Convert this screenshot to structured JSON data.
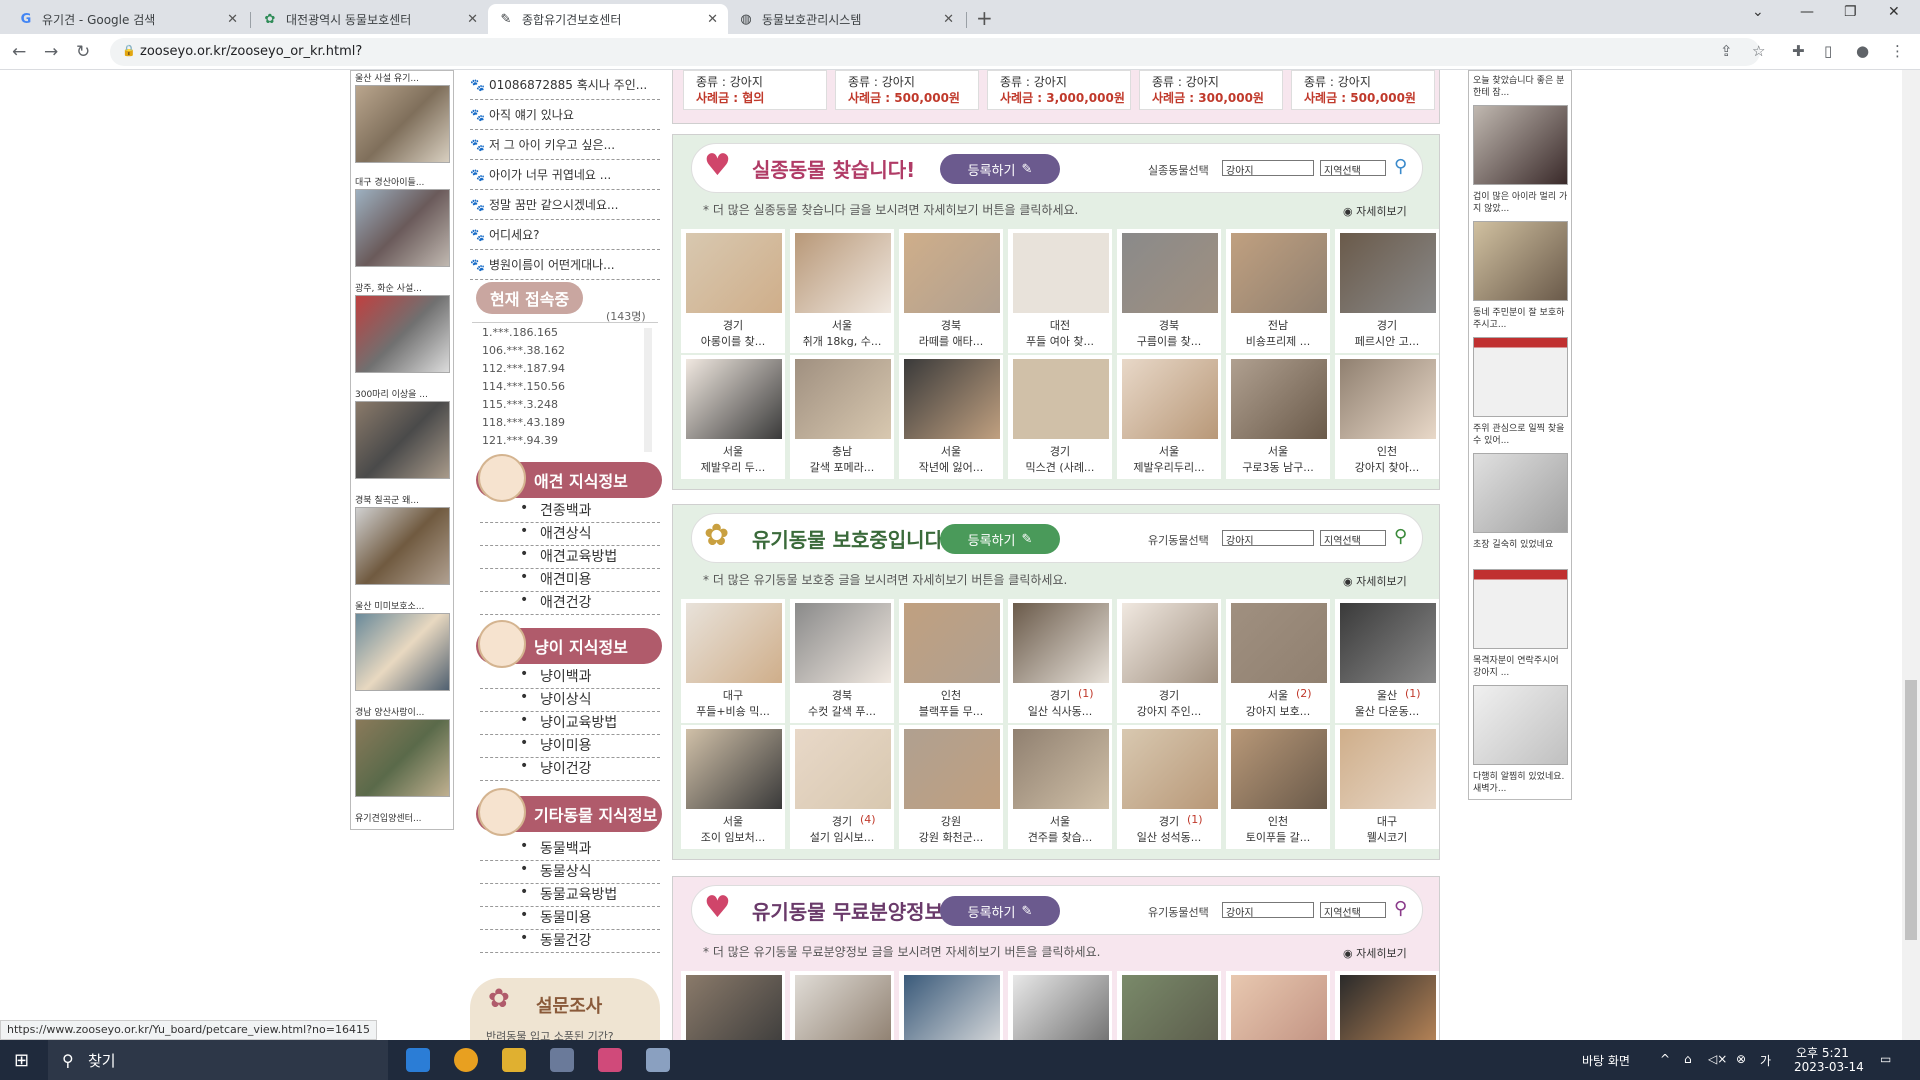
{
  "tabs": [
    {
      "title": "유기견 - Google 검색",
      "icon": "G"
    },
    {
      "title": "대전광역시 동물보호센터",
      "icon": "✿"
    },
    {
      "title": "종합유기견보호센터",
      "icon": "✎"
    },
    {
      "title": "동물보호관리시스템",
      "icon": "◍"
    }
  ],
  "url": "zooseyo.or.kr/zooseyo_or_kr.html?",
  "status_url": "https://www.zooseyo.or.kr/Yu_board/petcare_view.html?no=16415",
  "left_captions": [
    "울산 사설 유기...",
    "대구 경산아이들...",
    "광주, 화순 사설...",
    "300마리 이상을 ...",
    "경북 칠곡군 왜...",
    "울산 미미보호소...",
    "경남 양산사랑이...",
    "유기견입양센터..."
  ],
  "menu_items": [
    "01086872885 혹시나 주인...",
    "아직 얘기 있나요",
    "저 그 아이 키우고 싶은...",
    "아이가 너무 귀엽네요 ...",
    "정말 꿈만 같으시겠네요...",
    "어디세요?",
    "병원이름이 어떤게대나..."
  ],
  "now_online": {
    "label": "현재 접속중",
    "count": "(143명)",
    "ips": [
      "1.***.186.165",
      "106.***.38.162",
      "112.***.187.94",
      "114.***.150.56",
      "115.***.3.248",
      "118.***.43.189",
      "121.***.94.39"
    ]
  },
  "knowledge": [
    {
      "title": "애견 지식정보",
      "links": [
        "견종백과",
        "애견상식",
        "애견교육방법",
        "애견미용",
        "애견건강"
      ]
    },
    {
      "title": "냥이 지식정보",
      "links": [
        "냥이백과",
        "냥이상식",
        "냥이교육방법",
        "냥이미용",
        "냥이건강"
      ]
    },
    {
      "title": "기타동물 지식정보",
      "links": [
        "동물백과",
        "동물상식",
        "동물교육방법",
        "동물미용",
        "동물건강"
      ]
    }
  ],
  "survey": {
    "title": "설문조사",
    "text": "반려동물 입고 소풍된 기간?"
  },
  "top_rewards": [
    {
      "species": "종류 : 강아지",
      "reward": "사례금 : 협의"
    },
    {
      "species": "종류 : 강아지",
      "reward": "사례금 : 500,000원"
    },
    {
      "species": "종류 : 강아지",
      "reward": "사례금 : 3,000,000원"
    },
    {
      "species": "종류 : 강아지",
      "reward": "사례금 : 300,000원"
    },
    {
      "species": "종류 : 강아지",
      "reward": "사례금 : 500,000원"
    }
  ],
  "sections": [
    {
      "title": "실종동물 찾습니다!",
      "register": "등록하기",
      "select_label": "실종동물선택",
      "select_value": "강아지",
      "region": "지역선택",
      "note": "* 더 많은 실종동물 찾습니다 글을 보시려면 자세히보기 버튼을 클릭하세요.",
      "more": "자세히보기",
      "cards": [
        {
          "region": "경기",
          "text": "아롱이를 찾...",
          "count": ""
        },
        {
          "region": "서울",
          "text": "취개 18kg, 수...",
          "count": ""
        },
        {
          "region": "경북",
          "text": "라떼를 애타...",
          "count": ""
        },
        {
          "region": "대전",
          "text": "푸들 여아 찾...",
          "count": ""
        },
        {
          "region": "경북",
          "text": "구름이를 찾...",
          "count": ""
        },
        {
          "region": "전남",
          "text": "비숑프리제 ...",
          "count": ""
        },
        {
          "region": "경기",
          "text": "페르시안 고...",
          "count": ""
        },
        {
          "region": "서울",
          "text": "제발우리 두...",
          "count": ""
        },
        {
          "region": "충남",
          "text": "갈색 포메라...",
          "count": ""
        },
        {
          "region": "서울",
          "text": "작년에 잃어...",
          "count": ""
        },
        {
          "region": "경기",
          "text": "믹스견 (사례...",
          "count": ""
        },
        {
          "region": "서울",
          "text": "제발우리두리...",
          "count": ""
        },
        {
          "region": "서울",
          "text": "구로3동 남구...",
          "count": ""
        },
        {
          "region": "인천",
          "text": "강아지 찾아...",
          "count": ""
        }
      ]
    },
    {
      "title": "유기동물 보호중입니다!",
      "register": "등록하기",
      "select_label": "유기동물선택",
      "select_value": "강아지",
      "region": "지역선택",
      "note": "* 더 많은 유기동물 보호중 글을 보시려면 자세히보기 버튼을 클릭하세요.",
      "more": "자세히보기",
      "cards": [
        {
          "region": "대구",
          "text": "푸들+비숑 믹...",
          "count": ""
        },
        {
          "region": "경북",
          "text": "수컷 갈색 푸...",
          "count": ""
        },
        {
          "region": "인천",
          "text": "블랙푸들 무...",
          "count": ""
        },
        {
          "region": "경기",
          "text": "일산 식사동...",
          "count": "(1)"
        },
        {
          "region": "경기",
          "text": "강아지 주인...",
          "count": ""
        },
        {
          "region": "서울",
          "text": "강아지 보호...",
          "count": "(2)"
        },
        {
          "region": "울산",
          "text": "울산 다운동...",
          "count": "(1)"
        },
        {
          "region": "서울",
          "text": "조이 임보처...",
          "count": ""
        },
        {
          "region": "경기",
          "text": "설기 임시보...",
          "count": "(4)"
        },
        {
          "region": "강원",
          "text": "강원 화천군...",
          "count": ""
        },
        {
          "region": "서울",
          "text": "견주를 찾습...",
          "count": ""
        },
        {
          "region": "경기",
          "text": "일산 성석동...",
          "count": "(1)"
        },
        {
          "region": "인천",
          "text": "토이푸들 갈...",
          "count": ""
        },
        {
          "region": "대구",
          "text": "웰시코기",
          "count": ""
        }
      ]
    },
    {
      "title": "유기동물 무료분양정보",
      "register": "등록하기",
      "select_label": "유기동물선택",
      "select_value": "강아지",
      "region": "지역선택",
      "note": "* 더 많은 유기동물 무료분양정보 글을 보시려면 자세히보기 버튼을 클릭하세요.",
      "more": "자세히보기",
      "cards": []
    }
  ],
  "right_captions": [
    "오늘 찾았습니다 좋은 분한테 잠...",
    "겁이 많은 아이라 멀리 가지 않았...",
    "동네 주민분이 잘 보호하주시고...",
    "주위 관심으로 일찍 찾을수 있어...",
    "초장 길숙히 있었네요",
    "목격자분이 연락주시어 강아지 ...",
    "다행히 알찜히 있었네요. 새벽가..."
  ],
  "taskbar": {
    "search": "찾기",
    "desktop": "바탕 화면",
    "time": "오후 5:21",
    "date": "2023-03-14"
  },
  "colors": {
    "pink_panel": "#f7e6ee",
    "green_panel": "#e4efe4",
    "title_pink": "#b03b66",
    "register": "#6b5a8e",
    "badge": "#b05b6b"
  }
}
